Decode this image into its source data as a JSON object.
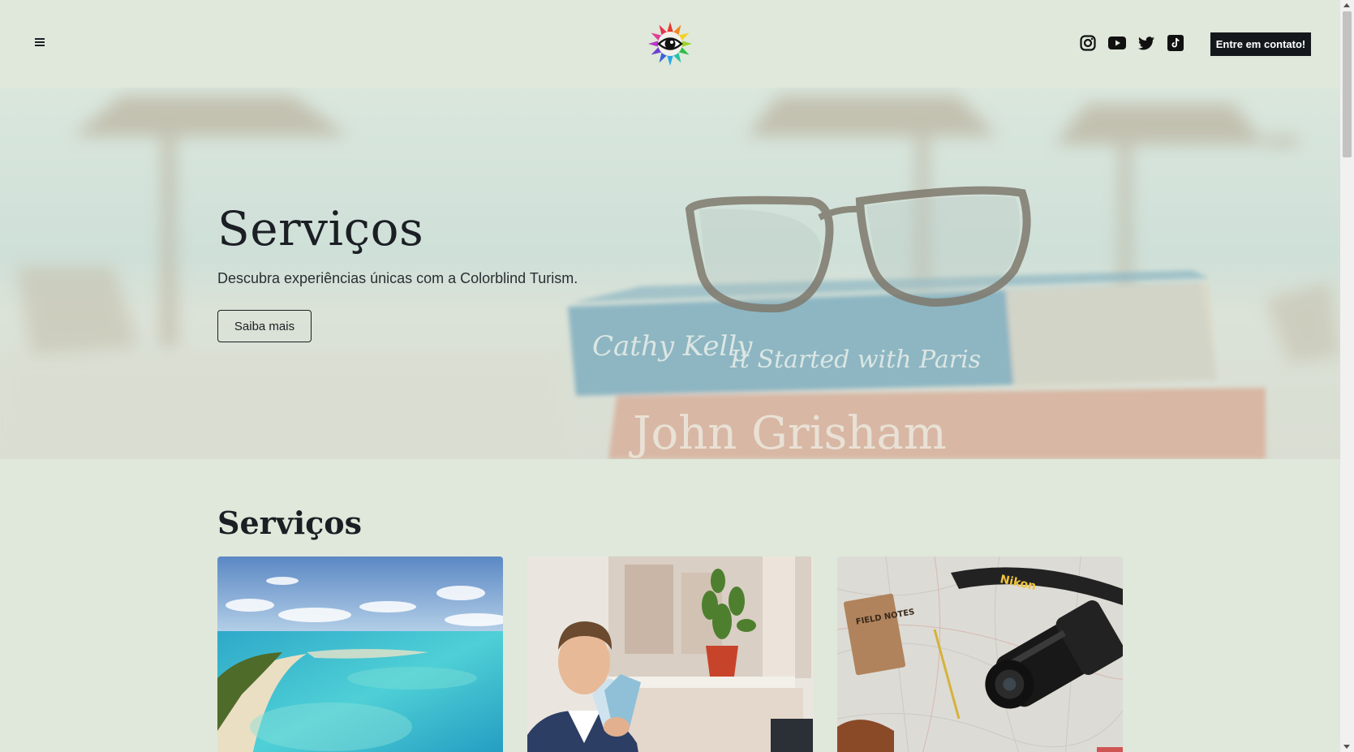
{
  "header": {
    "menu_icon": "hamburger-menu-icon",
    "logo_icon": "rainbow-eye-logo",
    "social_icons": [
      "instagram-icon",
      "youtube-icon",
      "twitter-icon",
      "tiktok-icon"
    ],
    "cta_label": "Entre em contato!"
  },
  "hero": {
    "title": "Serviços",
    "subtitle": "Descubra experiências únicas com a Colorblind Turism.",
    "button_label": "Saiba mais",
    "image_book_author_1": "Cathy Kelly",
    "image_book_title_1": "It Started with Paris",
    "image_book_author_2": "John Grisham"
  },
  "services": {
    "title": "Serviços",
    "cards": [
      {
        "image": "tropical-beach-aerial-photo"
      },
      {
        "image": "man-holding-tickets-photo"
      },
      {
        "image": "map-camera-notebook-photo",
        "notebook_text": "FIELD NOTES",
        "strap_text": "Nikon"
      }
    ]
  },
  "colors": {
    "background": "#dfe8da",
    "text": "#1b1f24",
    "cta_background": "#14181c"
  }
}
